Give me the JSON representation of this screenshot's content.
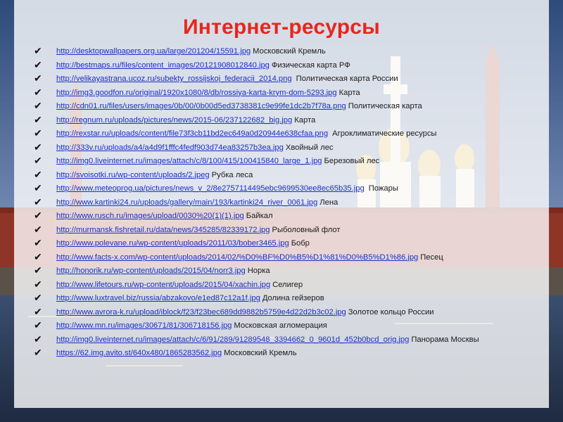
{
  "title": "Интернет-ресурсы",
  "check_icon": "checkmark-icon",
  "colors": {
    "title": "#e8261c",
    "link": "#1a2ec8"
  },
  "resources": [
    {
      "url": "http://desktopwallpapers.org.ua/large/201204/15591.jpg",
      "desc": "Московский Кремль"
    },
    {
      "url": "http://bestmaps.ru/files/content_images/20121908012840.jpg",
      "desc": "Физическая карта РФ"
    },
    {
      "url": "http://velikayastrana.ucoz.ru/subekty_rossijskoj_federacii_2014.png",
      "desc": " Политическая карта России"
    },
    {
      "url": "http://img3.goodfon.ru/original/1920x1080/8/db/rossiya-karta-krym-dom-5293.jpg",
      "desc": "Карта"
    },
    {
      "url": "http://cdn01.ru/files/users/images/0b/00/0b00d5ed3738381c9e99fe1dc2b7f78a.png",
      "desc": "Политическая карта"
    },
    {
      "url": "http://regnum.ru/uploads/pictures/news/2015-06/237122682_big.jpg",
      "desc": "Карта"
    },
    {
      "url": "http://rexstar.ru/uploads/content/file73f3cb11bd2ec649a0d20944e638cfaa.png",
      "desc": " Агроклиматические ресурсы"
    },
    {
      "url": "http://333v.ru/uploads/a4/a4d9f1fffc4fedf903d74ea83257b3ea.jpg",
      "desc": "Хвойный лес"
    },
    {
      "url": "http://img0.liveinternet.ru/images/attach/c/8/100/415/100415840_large_1.jpg",
      "desc": "Березовый лес"
    },
    {
      "url": "http://svoisotki.ru/wp-content/uploads/2.jpeg",
      "desc": "Рубка леса"
    },
    {
      "url": "http://www.meteoprog.ua/pictures/news_v_2/8e2757114495ebc9699530ee8ec65b35.jpg",
      "desc": " Пожары"
    },
    {
      "url": "http://www.kartinki24.ru/uploads/gallery/main/193/kartinki24_river_0061.jpg",
      "desc": "Лена"
    },
    {
      "url": "http://www.rusch.ru/images/upload/0030%20(1)(1).jpg",
      "desc": "Байкал"
    },
    {
      "url": "http://murmansk.fishretail.ru/data/news/345285/82339172.jpg",
      "desc": "Рыболовный флот"
    },
    {
      "url": "http://www.polevane.ru/wp-content/uploads/2011/03/bober3465.jpg",
      "desc": "Бобр"
    },
    {
      "url": "http://www.facts-x.com/wp-content/uploads/2014/02/%D0%BF%D0%B5%D1%81%D0%B5%D1%86.jpg",
      "desc": "Песец"
    },
    {
      "url": "http://honorik.ru/wp-content/uploads/2015/04/norr3.jpg",
      "desc": "Норка"
    },
    {
      "url": "http://www.lifetours.ru/wp-content/uploads/2015/04/xachin.jpg",
      "desc": "Селигер"
    },
    {
      "url": "http://www.luxtravel.biz/russia/abzakovo/e1ed87c12a1f.jpg",
      "desc": "Долина гейзеров"
    },
    {
      "url": "http://www.avrora-k.ru/upload/iblock/f23/f23bec689dd9882b5759e4d22d2b3c02.jpg",
      "desc": "Золотое кольцо России"
    },
    {
      "url": "http://www.mn.ru/images/30671/81/306718156.jpg",
      "desc": "Московская агломерация"
    },
    {
      "url": "http://img0.liveinternet.ru/images/attach/c/6/91/289/91289548_3394662_0_9601d_452b0bcd_orig.jpg",
      "desc": "Панорама Москвы"
    },
    {
      "url": "https://62.img.avito.st/640x480/1865283562.jpg",
      "desc": "Московский Кремль"
    }
  ]
}
